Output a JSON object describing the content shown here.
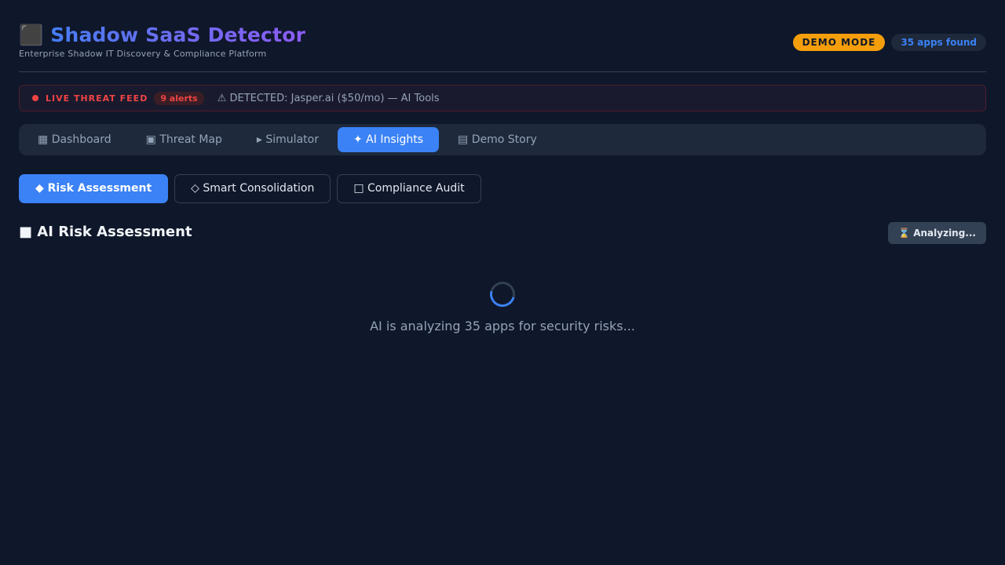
{
  "header": {
    "logo_icon": "shadow-icon",
    "title_icon_glyph": "⬛",
    "title": "Shadow SaaS Detector",
    "subtitle": "Enterprise Shadow IT Discovery & Compliance Platform",
    "demo_badge": "DEMO MODE",
    "apps_badge": "35 apps found"
  },
  "threat_feed": {
    "label": "LIVE THREAT FEED",
    "alert_count": "9 alerts",
    "message_icon_glyph": "⚠",
    "message": "DETECTED: Jasper.ai ($50/mo) — AI Tools"
  },
  "nav": {
    "tabs": [
      {
        "icon": "dashboard-icon",
        "glyph": "▦",
        "label": "Dashboard",
        "active": false
      },
      {
        "icon": "map-icon",
        "glyph": "▣",
        "label": "Threat Map",
        "active": false
      },
      {
        "icon": "simulator-icon",
        "glyph": "▸",
        "label": "Simulator",
        "active": false
      },
      {
        "icon": "ai-icon",
        "glyph": "✦",
        "label": "AI Insights",
        "active": true
      },
      {
        "icon": "story-icon",
        "glyph": "▤",
        "label": "Demo Story",
        "active": false
      }
    ]
  },
  "subtabs": [
    {
      "icon": "shield-icon",
      "glyph": "◆",
      "label": "Risk Assessment",
      "active": true
    },
    {
      "icon": "merge-icon",
      "glyph": "◇",
      "label": "Smart Consolidation",
      "active": false
    },
    {
      "icon": "clipboard-icon",
      "glyph": "□",
      "label": "Compliance Audit",
      "active": false
    }
  ],
  "section": {
    "icon": "robot-icon",
    "glyph": "■",
    "title": "AI Risk Assessment",
    "button_icon_glyph": "⌛",
    "button_label": "Analyzing..."
  },
  "loader": {
    "text": "AI is analyzing 35 apps for security risks..."
  },
  "colors": {
    "background": "#0f172a",
    "accent": "#3b82f6",
    "warning": "#f59e0b",
    "danger": "#ef4444"
  }
}
